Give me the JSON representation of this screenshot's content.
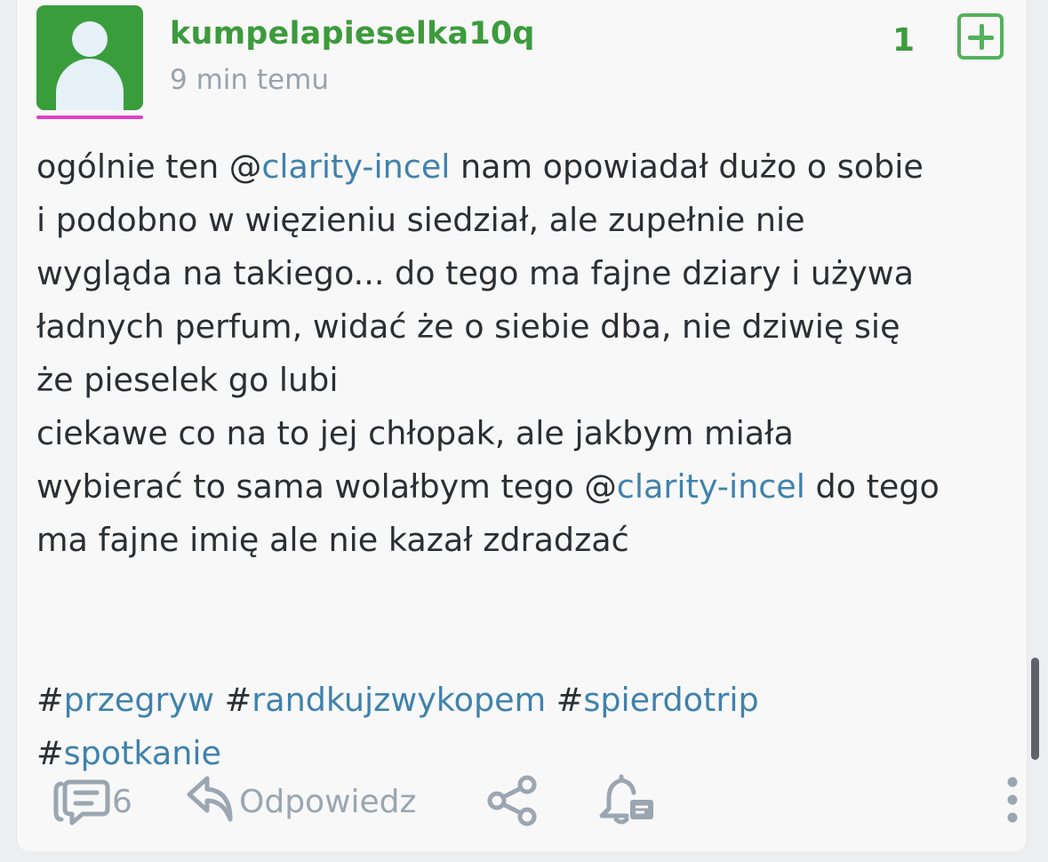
{
  "post": {
    "author": "kumpelapieselka10q",
    "time_ago": "9 min temu",
    "score": "1",
    "lines": [
      [
        {
          "text": "ogólnie ten @"
        },
        {
          "text": "clarity-incel",
          "link": true
        },
        {
          "text": " nam opowiadał dużo o sobie"
        }
      ],
      [
        {
          "text": "i podobno w więzieniu siedział, ale zupełnie nie"
        }
      ],
      [
        {
          "text": "wygląda na takiego... do tego ma fajne dziary i używa"
        }
      ],
      [
        {
          "text": "ładnych perfum, widać że o siebie dba, nie dziwię się"
        }
      ],
      [
        {
          "text": "że pieselek go lubi"
        }
      ],
      [
        {
          "text": "ciekawe co na to jej chłopak, ale jakbym miała"
        }
      ],
      [
        {
          "text": "wybierać to sama wolałbym tego @"
        },
        {
          "text": "clarity-incel",
          "link": true
        },
        {
          "text": " do tego"
        }
      ],
      [
        {
          "text": "ma fajne imię ale nie kazał zdradzać"
        }
      ]
    ],
    "tags_lines": [
      [
        "przegryw",
        "randkujzwykopem",
        "spierdotrip"
      ],
      [
        "spotkanie"
      ]
    ]
  },
  "footer": {
    "comments_count": "6",
    "reply_label": "Odpowiedz"
  },
  "colors": {
    "author": "#3c9b3c",
    "link": "#3f82ad",
    "muted": "#9aa6b1",
    "avatar_bg": "#3a9d3c",
    "avatar_underline": "#e040c8"
  }
}
